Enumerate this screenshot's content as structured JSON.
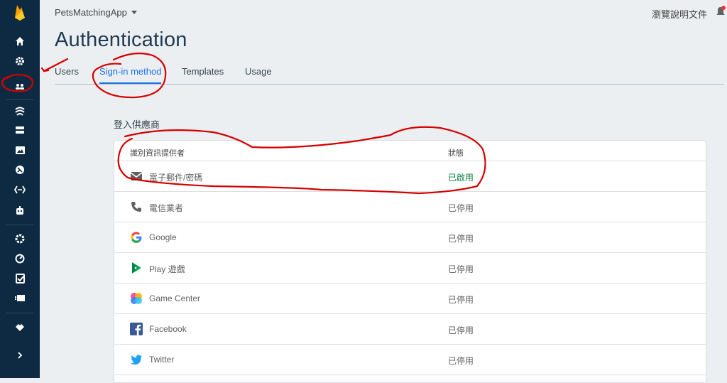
{
  "app": {
    "project_name": "PetsMatchingApp",
    "docs_link": "瀏覽說明文件",
    "page_title": "Authentication"
  },
  "tabs": [
    {
      "label": "Users"
    },
    {
      "label": "Sign-in method",
      "active": true
    },
    {
      "label": "Templates"
    },
    {
      "label": "Usage"
    }
  ],
  "providers": {
    "section_title": "登入供應商",
    "col_provider": "識別資訊提供者",
    "col_status": "狀態",
    "rows": [
      {
        "name": "電子郵件/密碼",
        "status": "已啟用",
        "icon": "email-icon",
        "enabled": true
      },
      {
        "name": "電信業者",
        "status": "已停用",
        "icon": "phone-icon",
        "enabled": false
      },
      {
        "name": "Google",
        "status": "已停用",
        "icon": "google-icon",
        "enabled": false
      },
      {
        "name": "Play 遊戲",
        "status": "已停用",
        "icon": "play-games-icon",
        "enabled": false
      },
      {
        "name": "Game Center",
        "status": "已停用",
        "icon": "game-center-icon",
        "enabled": false
      },
      {
        "name": "Facebook",
        "status": "已停用",
        "icon": "facebook-icon",
        "enabled": false
      },
      {
        "name": "Twitter",
        "status": "已停用",
        "icon": "twitter-icon",
        "enabled": false
      }
    ]
  },
  "sidebar": {
    "items": [
      {
        "icon": "firebase-logo-icon"
      },
      {
        "icon": "home-icon"
      },
      {
        "icon": "gear-icon"
      },
      {
        "icon": "authentication-icon",
        "active": true
      },
      {
        "icon": "database-icon"
      },
      {
        "icon": "storage-icon"
      },
      {
        "icon": "hosting-icon"
      },
      {
        "icon": "functions-icon"
      },
      {
        "icon": "ml-kit-icon"
      },
      {
        "icon": "crashlytics-icon"
      },
      {
        "icon": "performance-icon"
      },
      {
        "icon": "test-lab-icon"
      },
      {
        "icon": "app-distribution-icon"
      },
      {
        "icon": "extensions-icon"
      },
      {
        "icon": "expand-icon"
      }
    ]
  },
  "colors": {
    "sidebar_bg": "#0e2a43",
    "accent": "#1a73e8",
    "enabled": "#0b8043",
    "annotation": "#d50000"
  }
}
